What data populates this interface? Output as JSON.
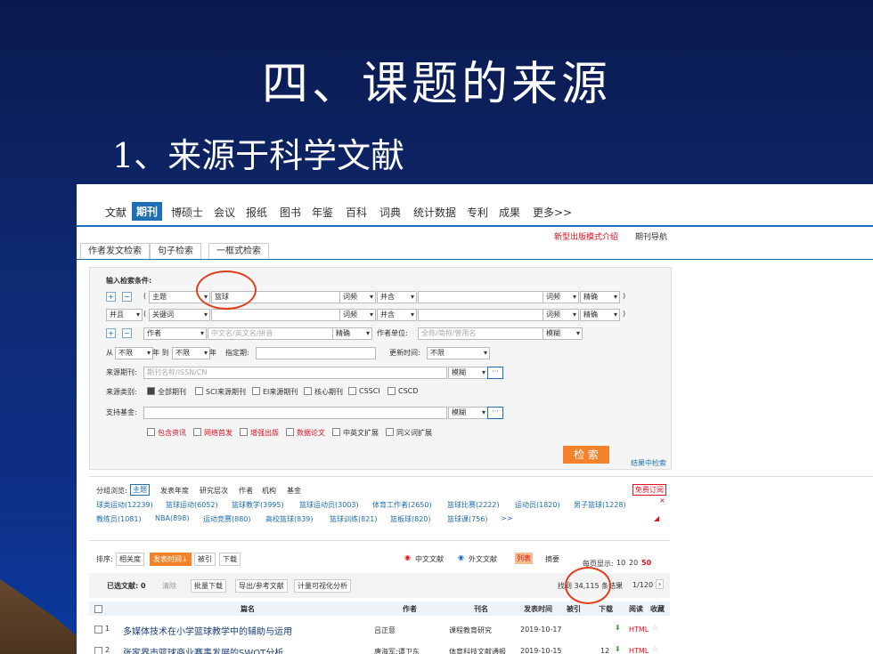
{
  "slide": {
    "title": "四、课题的来源",
    "subtitle": "1、来源于科学文献"
  },
  "colors": {
    "accent": "#1f6fb5",
    "highlight": "#f4822a",
    "annotation": "#e0401c"
  },
  "nav": {
    "items": [
      "文献",
      "期刊",
      "博硕士",
      "会议",
      "报纸",
      "图书",
      "年鉴",
      "百科",
      "词典",
      "统计数据",
      "专利",
      "成果",
      "更多>>"
    ],
    "active": "期刊",
    "new_mode": "新型出版模式介绍",
    "guide": "期刊导航"
  },
  "tabs": [
    "作者发文检索",
    "句子检索",
    "一框式检索"
  ],
  "search": {
    "heading": "输入检索条件:",
    "row1": {
      "field": "主题",
      "value": "篮球",
      "freq": "词频",
      "logic": "并含",
      "freq2": "词频",
      "match": "精确"
    },
    "row2": {
      "bool": "并且",
      "field": "关键词",
      "freq": "词频",
      "logic": "并含",
      "freq2": "词频",
      "match": "精确"
    },
    "row3": {
      "field": "作者",
      "placeholder": "中文名/英文名/拼音",
      "match": "精确",
      "unit_label": "作者单位:",
      "unit_placeholder": "全称/简称/曾用名",
      "unit_match": "模糊"
    },
    "date": {
      "from_label": "从",
      "from": "不限",
      "year1": "年 到",
      "to": "不限",
      "year2": "年",
      "specify": "指定期:",
      "update_label": "更新时间:",
      "update": "不限"
    },
    "source": {
      "label": "来源期刊:",
      "placeholder": "期刊名称/ISSN/CN",
      "match": "模糊"
    },
    "category": {
      "label": "来源类别:",
      "options": [
        "全部期刊",
        "SCI来源期刊",
        "EI来源期刊",
        "核心期刊",
        "CSSCI",
        "CSCD"
      ]
    },
    "fund": {
      "label": "支持基金:",
      "match": "模糊"
    },
    "extras": [
      "包含资讯",
      "网络首发",
      "增强出版",
      "数据论文",
      "中英文扩展",
      "同义词扩展"
    ],
    "button": "检 索",
    "in_results": "结果中检索"
  },
  "group": {
    "label": "分组浏览:",
    "tabs": [
      "主题",
      "发表年度",
      "研究层次",
      "作者",
      "机构",
      "基金"
    ],
    "subscribe": "免费订阅",
    "links1": [
      "球类运动(12239)",
      "篮球运动(6052)",
      "篮球教学(3995)",
      "篮球运动员(3003)",
      "体育工作者(2650)",
      "篮球比赛(2222)",
      "运动员(1820)",
      "男子篮球(1228)"
    ],
    "links2": [
      "教练员(1081)",
      "NBA(898)",
      "运动竞赛(880)",
      "高校篮球(839)",
      "篮球训练(821)",
      "篮板球(820)",
      "篮球课(756)",
      ">>"
    ]
  },
  "results": {
    "sort_label": "排序:",
    "sort": [
      "相关度",
      "发表时间↓",
      "被引",
      "下载"
    ],
    "lang": [
      "中文文献",
      "外文文献"
    ],
    "view": [
      "列表",
      "摘要"
    ],
    "per_page_label": "每页显示:",
    "per_page": [
      "10",
      "20",
      "50"
    ],
    "selected": "已选文献: 0",
    "clear": "清除",
    "bulk_download": "批量下载",
    "export": "导出/参考文献",
    "analyze": "计量可视化分析",
    "found": "找到 34,115 条结果",
    "pages": "1/120",
    "columns": [
      "篇名",
      "作者",
      "刊名",
      "发表时间",
      "被引",
      "下载",
      "阅读",
      "收藏"
    ],
    "rows": [
      {
        "no": "1",
        "title": "多媒体技术在小学篮球教学中的辅助与运用",
        "author": "吕正意",
        "journal": "课程教育研究",
        "date": "2019-10-17",
        "format": "HTML"
      },
      {
        "no": "2",
        "title": "张家界市篮球商业赛事发展的SWOT分析",
        "author": "唐海军;谭卫东",
        "journal": "体育科技文献通报",
        "date": "2019-10-15",
        "downloads": "12",
        "format": "HTML"
      }
    ]
  }
}
